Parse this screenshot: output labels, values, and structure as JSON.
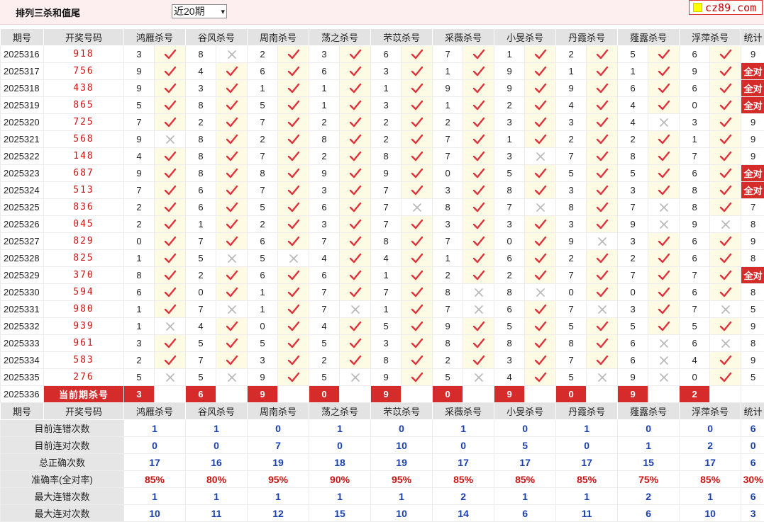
{
  "page": {
    "title": "排列三杀和值尾",
    "period_select": "近20期",
    "logo": "cz89.com"
  },
  "columns": {
    "issue": "期号",
    "draw": "开奖号码",
    "experts": [
      "鸿雁杀号",
      "谷风杀号",
      "周南杀号",
      "荡之杀号",
      "芣苡杀号",
      "采薇杀号",
      "小旻杀号",
      "丹霞杀号",
      "薤露杀号",
      "浮萍杀号"
    ],
    "stat": "统计"
  },
  "rows": [
    {
      "issue": "2025316",
      "draw": "918",
      "cells": [
        [
          "3",
          1
        ],
        [
          "8",
          0
        ],
        [
          "2",
          1
        ],
        [
          "3",
          1
        ],
        [
          "6",
          1
        ],
        [
          "7",
          1
        ],
        [
          "1",
          1
        ],
        [
          "2",
          1
        ],
        [
          "5",
          1
        ],
        [
          "6",
          1
        ]
      ],
      "stat": "9"
    },
    {
      "issue": "2025317",
      "draw": "756",
      "cells": [
        [
          "9",
          1
        ],
        [
          "4",
          1
        ],
        [
          "6",
          1
        ],
        [
          "6",
          1
        ],
        [
          "3",
          1
        ],
        [
          "1",
          1
        ],
        [
          "9",
          1
        ],
        [
          "1",
          1
        ],
        [
          "1",
          1
        ],
        [
          "9",
          1
        ]
      ],
      "stat": "全对"
    },
    {
      "issue": "2025318",
      "draw": "438",
      "cells": [
        [
          "9",
          1
        ],
        [
          "3",
          1
        ],
        [
          "1",
          1
        ],
        [
          "1",
          1
        ],
        [
          "1",
          1
        ],
        [
          "9",
          1
        ],
        [
          "9",
          1
        ],
        [
          "9",
          1
        ],
        [
          "6",
          1
        ],
        [
          "6",
          1
        ]
      ],
      "stat": "全对"
    },
    {
      "issue": "2025319",
      "draw": "865",
      "cells": [
        [
          "5",
          1
        ],
        [
          "8",
          1
        ],
        [
          "5",
          1
        ],
        [
          "1",
          1
        ],
        [
          "3",
          1
        ],
        [
          "1",
          1
        ],
        [
          "2",
          1
        ],
        [
          "4",
          1
        ],
        [
          "4",
          1
        ],
        [
          "0",
          1
        ]
      ],
      "stat": "全对"
    },
    {
      "issue": "2025320",
      "draw": "725",
      "cells": [
        [
          "7",
          1
        ],
        [
          "2",
          1
        ],
        [
          "7",
          1
        ],
        [
          "2",
          1
        ],
        [
          "2",
          1
        ],
        [
          "2",
          1
        ],
        [
          "3",
          1
        ],
        [
          "3",
          1
        ],
        [
          "4",
          0
        ],
        [
          "3",
          1
        ]
      ],
      "stat": "9"
    },
    {
      "issue": "2025321",
      "draw": "568",
      "cells": [
        [
          "9",
          0
        ],
        [
          "8",
          1
        ],
        [
          "2",
          1
        ],
        [
          "8",
          1
        ],
        [
          "2",
          1
        ],
        [
          "7",
          1
        ],
        [
          "1",
          1
        ],
        [
          "2",
          1
        ],
        [
          "2",
          1
        ],
        [
          "1",
          1
        ]
      ],
      "stat": "9"
    },
    {
      "issue": "2025322",
      "draw": "148",
      "cells": [
        [
          "4",
          1
        ],
        [
          "8",
          1
        ],
        [
          "7",
          1
        ],
        [
          "2",
          1
        ],
        [
          "8",
          1
        ],
        [
          "7",
          1
        ],
        [
          "3",
          0
        ],
        [
          "7",
          1
        ],
        [
          "8",
          1
        ],
        [
          "7",
          1
        ]
      ],
      "stat": "9"
    },
    {
      "issue": "2025323",
      "draw": "687",
      "cells": [
        [
          "9",
          1
        ],
        [
          "8",
          1
        ],
        [
          "8",
          1
        ],
        [
          "9",
          1
        ],
        [
          "9",
          1
        ],
        [
          "0",
          1
        ],
        [
          "5",
          1
        ],
        [
          "5",
          1
        ],
        [
          "5",
          1
        ],
        [
          "6",
          1
        ]
      ],
      "stat": "全对"
    },
    {
      "issue": "2025324",
      "draw": "513",
      "cells": [
        [
          "7",
          1
        ],
        [
          "6",
          1
        ],
        [
          "7",
          1
        ],
        [
          "3",
          1
        ],
        [
          "7",
          1
        ],
        [
          "3",
          1
        ],
        [
          "8",
          1
        ],
        [
          "3",
          1
        ],
        [
          "3",
          1
        ],
        [
          "8",
          1
        ]
      ],
      "stat": "全对"
    },
    {
      "issue": "2025325",
      "draw": "836",
      "cells": [
        [
          "2",
          1
        ],
        [
          "6",
          1
        ],
        [
          "5",
          1
        ],
        [
          "6",
          1
        ],
        [
          "7",
          0
        ],
        [
          "8",
          1
        ],
        [
          "7",
          0
        ],
        [
          "8",
          1
        ],
        [
          "7",
          0
        ],
        [
          "8",
          1
        ]
      ],
      "stat": "7"
    },
    {
      "issue": "2025326",
      "draw": "045",
      "cells": [
        [
          "2",
          1
        ],
        [
          "1",
          1
        ],
        [
          "2",
          1
        ],
        [
          "3",
          1
        ],
        [
          "7",
          1
        ],
        [
          "3",
          1
        ],
        [
          "3",
          1
        ],
        [
          "3",
          1
        ],
        [
          "9",
          0
        ],
        [
          "9",
          0
        ]
      ],
      "stat": "8"
    },
    {
      "issue": "2025327",
      "draw": "829",
      "cells": [
        [
          "0",
          1
        ],
        [
          "7",
          1
        ],
        [
          "6",
          1
        ],
        [
          "7",
          1
        ],
        [
          "8",
          1
        ],
        [
          "7",
          1
        ],
        [
          "0",
          1
        ],
        [
          "9",
          0
        ],
        [
          "3",
          1
        ],
        [
          "6",
          1
        ]
      ],
      "stat": "9"
    },
    {
      "issue": "2025328",
      "draw": "825",
      "cells": [
        [
          "1",
          1
        ],
        [
          "5",
          0
        ],
        [
          "5",
          0
        ],
        [
          "4",
          1
        ],
        [
          "4",
          1
        ],
        [
          "1",
          1
        ],
        [
          "6",
          1
        ],
        [
          "2",
          1
        ],
        [
          "2",
          1
        ],
        [
          "6",
          1
        ]
      ],
      "stat": "8"
    },
    {
      "issue": "2025329",
      "draw": "370",
      "cells": [
        [
          "8",
          1
        ],
        [
          "2",
          1
        ],
        [
          "6",
          1
        ],
        [
          "6",
          1
        ],
        [
          "1",
          1
        ],
        [
          "2",
          1
        ],
        [
          "2",
          1
        ],
        [
          "7",
          1
        ],
        [
          "7",
          1
        ],
        [
          "7",
          1
        ]
      ],
      "stat": "全对"
    },
    {
      "issue": "2025330",
      "draw": "594",
      "cells": [
        [
          "6",
          1
        ],
        [
          "0",
          1
        ],
        [
          "1",
          1
        ],
        [
          "7",
          1
        ],
        [
          "7",
          1
        ],
        [
          "8",
          0
        ],
        [
          "8",
          0
        ],
        [
          "0",
          1
        ],
        [
          "0",
          1
        ],
        [
          "6",
          1
        ]
      ],
      "stat": "8"
    },
    {
      "issue": "2025331",
      "draw": "980",
      "cells": [
        [
          "1",
          1
        ],
        [
          "7",
          0
        ],
        [
          "1",
          1
        ],
        [
          "7",
          0
        ],
        [
          "1",
          1
        ],
        [
          "7",
          0
        ],
        [
          "6",
          1
        ],
        [
          "7",
          0
        ],
        [
          "3",
          1
        ],
        [
          "7",
          0
        ]
      ],
      "stat": "5"
    },
    {
      "issue": "2025332",
      "draw": "939",
      "cells": [
        [
          "1",
          0
        ],
        [
          "4",
          1
        ],
        [
          "0",
          1
        ],
        [
          "4",
          1
        ],
        [
          "5",
          1
        ],
        [
          "9",
          1
        ],
        [
          "5",
          1
        ],
        [
          "5",
          1
        ],
        [
          "5",
          1
        ],
        [
          "5",
          1
        ]
      ],
      "stat": "9"
    },
    {
      "issue": "2025333",
      "draw": "961",
      "cells": [
        [
          "3",
          1
        ],
        [
          "5",
          1
        ],
        [
          "5",
          1
        ],
        [
          "5",
          1
        ],
        [
          "3",
          1
        ],
        [
          "8",
          1
        ],
        [
          "8",
          1
        ],
        [
          "8",
          1
        ],
        [
          "6",
          0
        ],
        [
          "6",
          0
        ]
      ],
      "stat": "8"
    },
    {
      "issue": "2025334",
      "draw": "583",
      "cells": [
        [
          "2",
          1
        ],
        [
          "7",
          1
        ],
        [
          "3",
          1
        ],
        [
          "2",
          1
        ],
        [
          "8",
          1
        ],
        [
          "2",
          1
        ],
        [
          "3",
          1
        ],
        [
          "7",
          1
        ],
        [
          "6",
          0
        ],
        [
          "4",
          1
        ]
      ],
      "stat": "9"
    },
    {
      "issue": "2025335",
      "draw": "276",
      "cells": [
        [
          "5",
          0
        ],
        [
          "5",
          0
        ],
        [
          "9",
          1
        ],
        [
          "5",
          0
        ],
        [
          "9",
          1
        ],
        [
          "5",
          0
        ],
        [
          "4",
          1
        ],
        [
          "5",
          0
        ],
        [
          "9",
          0
        ],
        [
          "0",
          1
        ]
      ],
      "stat": "5"
    }
  ],
  "current": {
    "issue": "2025336",
    "label": "当前期杀号",
    "kills": [
      "3",
      "6",
      "9",
      "0",
      "9",
      "0",
      "9",
      "0",
      "9",
      "2"
    ]
  },
  "summary": [
    {
      "label": "目前连错次数",
      "values": [
        "1",
        "1",
        "0",
        "1",
        "0",
        "1",
        "0",
        "1",
        "0",
        "0"
      ],
      "stat": "6"
    },
    {
      "label": "目前连对次数",
      "values": [
        "0",
        "0",
        "7",
        "0",
        "10",
        "0",
        "5",
        "0",
        "1",
        "2"
      ],
      "stat": "0"
    },
    {
      "label": "总正确次数",
      "values": [
        "17",
        "16",
        "19",
        "18",
        "19",
        "17",
        "17",
        "17",
        "15",
        "17"
      ],
      "stat": "6"
    },
    {
      "label": "准确率(全对率)",
      "values": [
        "85%",
        "80%",
        "95%",
        "90%",
        "95%",
        "85%",
        "85%",
        "85%",
        "75%",
        "85%"
      ],
      "stat": "30%",
      "pct": true
    },
    {
      "label": "最大连错次数",
      "values": [
        "1",
        "1",
        "1",
        "1",
        "1",
        "2",
        "1",
        "1",
        "2",
        "1"
      ],
      "stat": "6"
    },
    {
      "label": "最大连对次数",
      "values": [
        "10",
        "11",
        "12",
        "15",
        "10",
        "14",
        "6",
        "11",
        "6",
        "10"
      ],
      "stat": "3"
    }
  ],
  "colors": {
    "accent": "#d52b2b",
    "check": "#e0323c",
    "cross": "#b8b8b8",
    "value_blue": "#1a3fb0"
  }
}
